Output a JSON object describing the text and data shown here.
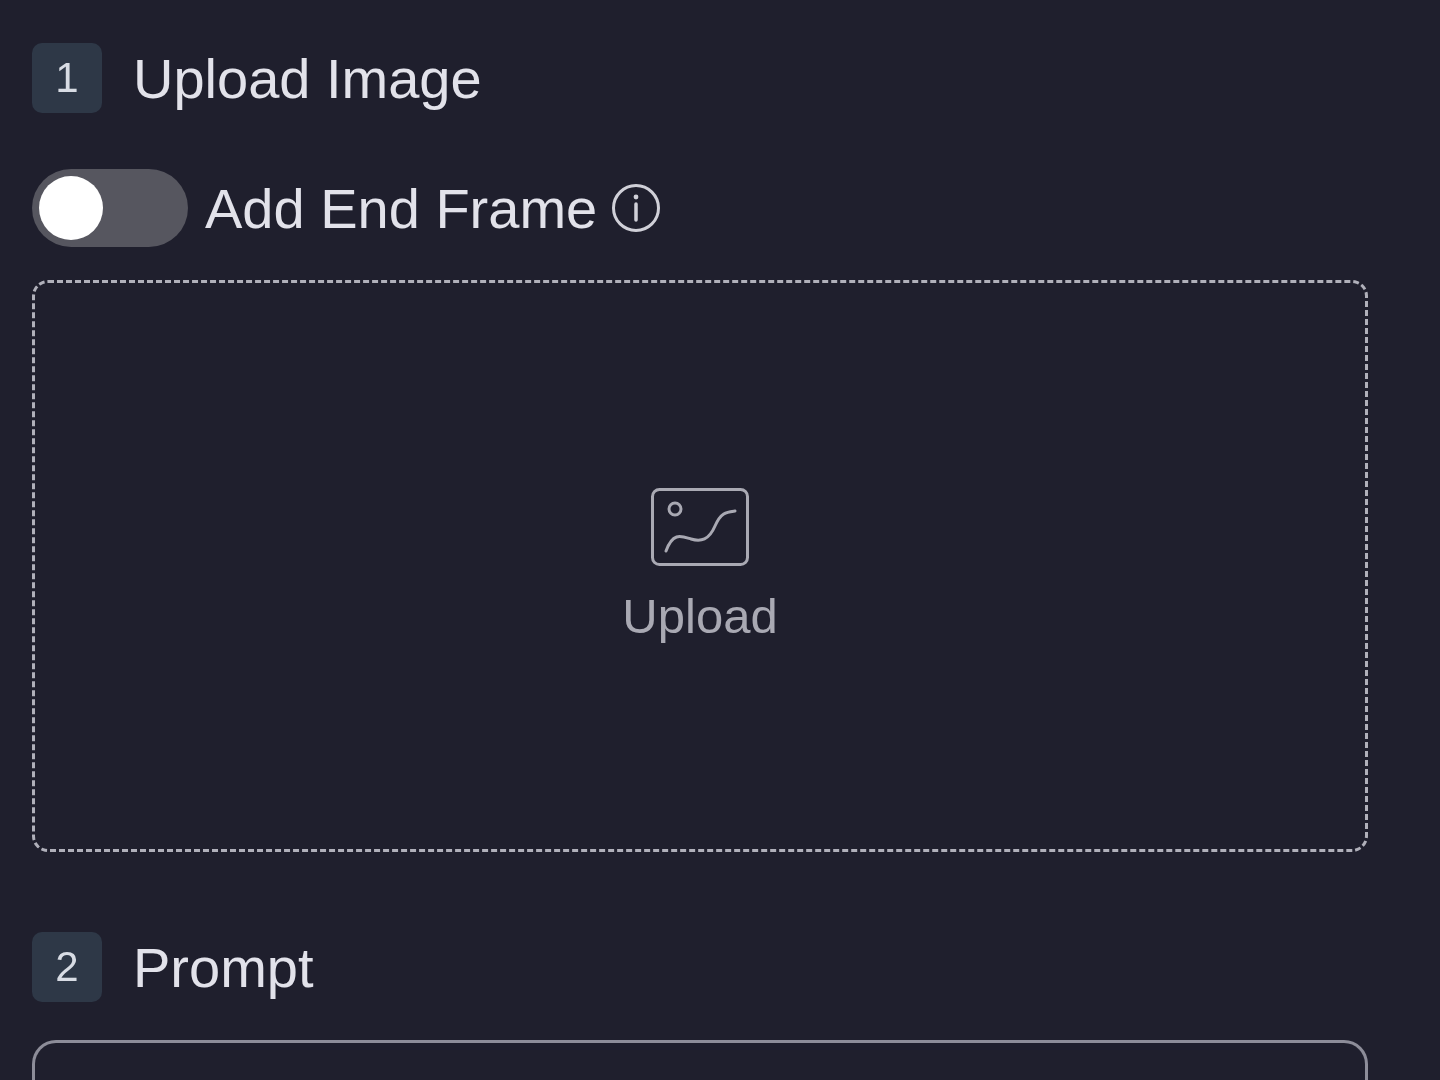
{
  "sections": [
    {
      "kind": "upload",
      "number": "1",
      "title": "Upload Image",
      "toggle": {
        "label": "Add End Frame",
        "on": false
      },
      "dropzone": {
        "label": "Upload"
      }
    },
    {
      "kind": "prompt",
      "number": "2",
      "title": "Prompt"
    }
  ]
}
